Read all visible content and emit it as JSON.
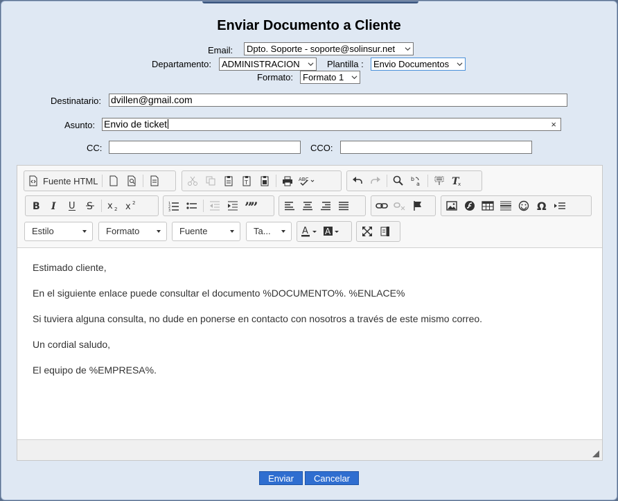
{
  "dialog": {
    "title": "Enviar Documento a Cliente"
  },
  "form": {
    "email_label": "Email:",
    "email_value": "Dpto. Soporte - soporte@solinsur.net",
    "departamento_label": "Departamento:",
    "departamento_value": "ADMINISTRACION",
    "plantilla_label": "Plantilla :",
    "plantilla_value": "Envio Documentos",
    "formato_label": "Formato:",
    "formato_value": "Formato 1",
    "destinatario_label": "Destinatario:",
    "destinatario_value": "dvillen@gmail.com",
    "asunto_label": "Asunto:",
    "asunto_value": "Envio de ticket",
    "cc_label": "CC:",
    "cc_value": "",
    "cco_label": "CCO:",
    "cco_value": ""
  },
  "toolbar": {
    "source_label": "Fuente HTML",
    "style_combo": "Estilo",
    "format_combo": "Formato",
    "font_combo": "Fuente",
    "size_combo": "Ta...",
    "text_color_glyph": "A",
    "bg_color_glyph": "A",
    "icons": {
      "source": "html-source-icon",
      "newpage": "new-page-icon",
      "preview": "preview-icon",
      "templates": "templates-icon",
      "cut": "cut-icon",
      "copy": "copy-icon",
      "paste": "paste-icon",
      "paste_text": "paste-text-icon",
      "paste_word": "paste-word-icon",
      "print": "print-icon",
      "spellcheck": "spellcheck-icon",
      "undo": "undo-icon",
      "redo": "redo-icon",
      "find": "find-icon",
      "replace": "replace-icon",
      "select_all": "select-all-icon",
      "remove_format": "remove-format-icon",
      "bold": "bold-icon",
      "italic": "italic-icon",
      "underline": "underline-icon",
      "strike": "strike-icon",
      "subscript": "subscript-icon",
      "superscript": "superscript-icon",
      "numbered_list": "numbered-list-icon",
      "bulleted_list": "bulleted-list-icon",
      "outdent": "outdent-icon",
      "indent": "indent-icon",
      "blockquote": "blockquote-icon",
      "align_left": "align-left-icon",
      "align_center": "align-center-icon",
      "align_right": "align-right-icon",
      "justify": "justify-icon",
      "link": "link-icon",
      "unlink": "unlink-icon",
      "anchor": "anchor-flag-icon",
      "image": "image-icon",
      "flash": "flash-icon",
      "table": "table-icon",
      "hline": "horizontal-line-icon",
      "smiley": "smiley-icon",
      "special_char": "omega-icon",
      "page_break": "page-break-icon",
      "maximize": "maximize-icon",
      "show_blocks": "show-blocks-icon"
    }
  },
  "editor": {
    "lines": [
      "Estimado cliente,",
      "En el siguiente enlace puede consultar el documento %DOCUMENTO%. %ENLACE%",
      "Si tuviera alguna consulta, no dude en ponerse en contacto con nosotros a través de este mismo correo.",
      "Un cordial saludo,",
      "El equipo de %EMPRESA%."
    ]
  },
  "actions": {
    "send_label": "Enviar",
    "cancel_label": "Cancelar"
  },
  "colors": {
    "dialog_bg": "#dfe8f3",
    "button_blue": "#2f6ed0"
  }
}
